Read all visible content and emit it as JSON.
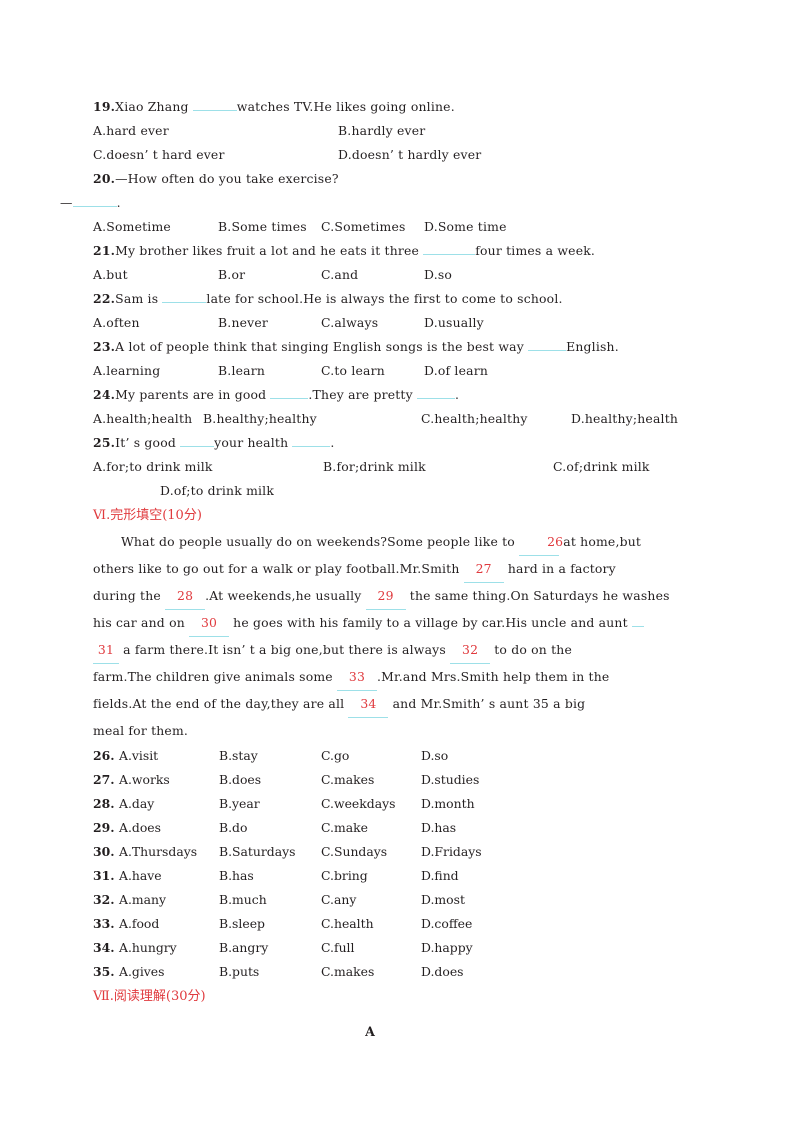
{
  "document": {
    "type": "english-exam-worksheet",
    "blank_underline_color": "#9de0e8",
    "accent_color": "#e03a3e",
    "text_color": "#231f20"
  },
  "multiple_choice": [
    {
      "number": "19.",
      "stem_before": "Xiao Zhang ",
      "stem_after": "watches TV.He likes going online.",
      "option_rows": [
        {
          "a": "A.hard ever",
          "b": "B.hardly ever"
        },
        {
          "a": "C.doesn’ t hard ever",
          "b": "D.doesn’ t hardly ever"
        }
      ]
    },
    {
      "number": "20.",
      "stem_before": "—How often do you take exercise?",
      "stem_reply_prefix": "—",
      "stem_reply_suffix": ".",
      "options": [
        "A.Sometime",
        "B.Some times",
        "C.Sometimes",
        "D.Some time"
      ]
    },
    {
      "number": "21.",
      "stem_before": "My brother likes fruit a lot and he eats it three ",
      "stem_after": "four times a week.",
      "options": [
        "A.but",
        "B.or",
        "C.and",
        "D.so"
      ]
    },
    {
      "number": "22.",
      "stem_before": "Sam is ",
      "stem_after": "late for school.He is always the first to come to school.",
      "options": [
        "A.often",
        "B.never",
        "C.always",
        "D.usually"
      ]
    },
    {
      "number": "23.",
      "stem_before": "A lot of people think that singing English songs is the best way ",
      "stem_after": "English.",
      "options": [
        "A.learning",
        "B.learn",
        "C.to learn",
        "D.of learn"
      ]
    },
    {
      "number": "24.",
      "stem_before": "My parents are in good ",
      "stem_middle": ".They are pretty ",
      "stem_after": ".",
      "options": [
        "A.health;health",
        "B.healthy;healthy",
        "C.health;healthy",
        "D.healthy;health"
      ]
    },
    {
      "number": "25.",
      "stem_before": "It’ s good ",
      "stem_middle": "your health ",
      "stem_after": ".",
      "options": [
        "A.for;to drink milk",
        "B.for;drink milk",
        "C.of;drink milk",
        "D.of;to drink milk"
      ]
    }
  ],
  "cloze_section": {
    "heading": "Ⅵ.完形填空(10分)",
    "passage_lines": [
      {
        "parts": [
          {
            "type": "text",
            "value": "What do people usually do on weekends?Some people like to "
          },
          {
            "type": "blank",
            "value": "26"
          },
          {
            "type": "text",
            "value": " at home,but"
          }
        ]
      },
      {
        "parts": [
          {
            "type": "text",
            "value": "others like to go out for a walk or play football.Mr.Smith "
          },
          {
            "type": "blank",
            "value": "27"
          },
          {
            "type": "text",
            "value": " hard in a factory"
          }
        ]
      },
      {
        "parts": [
          {
            "type": "text",
            "value": "during the "
          },
          {
            "type": "blank",
            "value": "28"
          },
          {
            "type": "text",
            "value": ".At weekends,he usually "
          },
          {
            "type": "blank",
            "value": "29"
          },
          {
            "type": "text",
            "value": " the same thing.On Saturdays he washes"
          }
        ]
      },
      {
        "parts": [
          {
            "type": "text",
            "value": "his car and on "
          },
          {
            "type": "blank",
            "value": "30"
          },
          {
            "type": "text",
            "value": " he goes with his family to a village by car.His uncle and aunt "
          },
          {
            "type": "blank-tail",
            "value": ""
          }
        ]
      },
      {
        "parts": [
          {
            "type": "blank-head",
            "value": "31"
          },
          {
            "type": "text",
            "value": " a farm there.It isn’ t a big one,but there is always "
          },
          {
            "type": "blank",
            "value": "32"
          },
          {
            "type": "text",
            "value": " to do on the"
          }
        ]
      },
      {
        "parts": [
          {
            "type": "text",
            "value": "farm.The children give animals some "
          },
          {
            "type": "blank",
            "value": "33"
          },
          {
            "type": "text",
            "value": ".Mr.and Mrs.Smith help them in the"
          }
        ]
      },
      {
        "parts": [
          {
            "type": "text",
            "value": "fields.At the end of the day,they are all "
          },
          {
            "type": "blank",
            "value": "34"
          },
          {
            "type": "text",
            "value": " and Mr.Smith’ s aunt "
          },
          {
            "type": "blank",
            "value": "35"
          },
          {
            "type": "text",
            "value": " a big"
          }
        ]
      },
      {
        "parts": [
          {
            "type": "text",
            "value": "meal for them."
          }
        ]
      }
    ],
    "questions": [
      {
        "number": "26.",
        "a": "A.visit",
        "b": "B.stay",
        "c": "C.go",
        "d": "D.so"
      },
      {
        "number": "27.",
        "a": "A.works",
        "b": "B.does",
        "c": "C.makes",
        "d": "D.studies"
      },
      {
        "number": "28.",
        "a": "A.day",
        "b": "B.year",
        "c": "C.weekdays",
        "d": "D.month"
      },
      {
        "number": "29.",
        "a": "A.does",
        "b": "B.do",
        "c": "C.make",
        "d": "D.has"
      },
      {
        "number": "30.",
        "a": "A.Thursdays",
        "b": "B.Saturdays",
        "c": "C.Sundays",
        "d": "D.Fridays"
      },
      {
        "number": "31.",
        "a": "A.have",
        "b": "B.has",
        "c": "C.bring",
        "d": "D.find"
      },
      {
        "number": "32.",
        "a": "A.many",
        "b": "B.much",
        "c": "C.any",
        "d": "D.most"
      },
      {
        "number": "33.",
        "a": "A.food",
        "b": "B.sleep",
        "c": "C.health",
        "d": "D.coffee"
      },
      {
        "number": "34.",
        "a": "A.hungry",
        "b": "B.angry",
        "c": "C.full",
        "d": "D.happy"
      },
      {
        "number": "35.",
        "a": "A.gives",
        "b": "B.puts",
        "c": "C.makes",
        "d": "D.does"
      }
    ]
  },
  "reading_section": {
    "heading": "Ⅶ.阅读理解(30分)",
    "passage_label": "A"
  }
}
